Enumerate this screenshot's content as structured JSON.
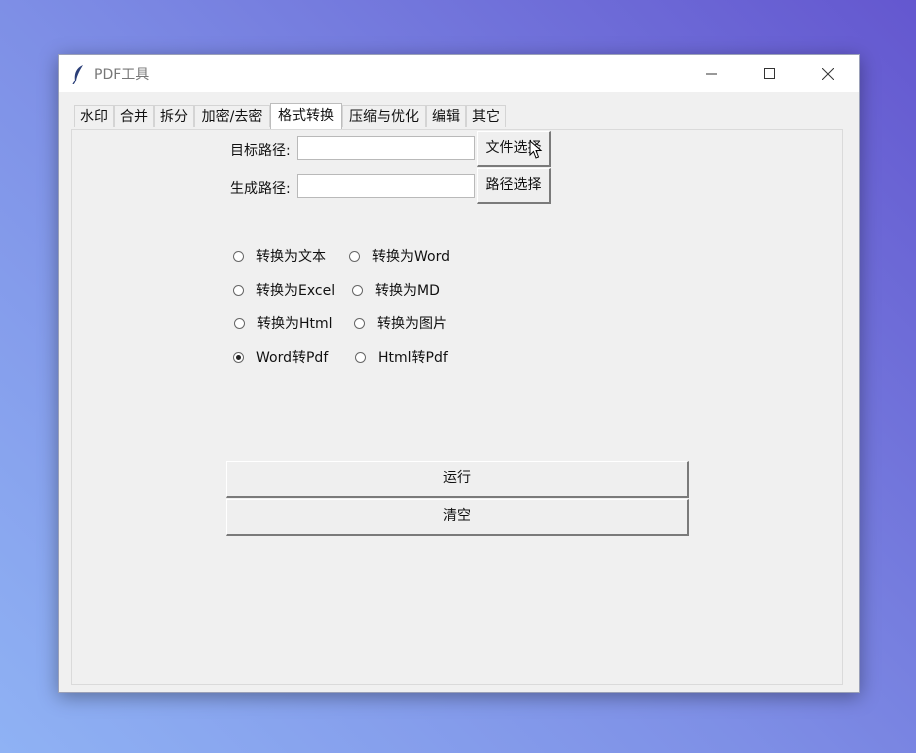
{
  "window": {
    "title": "PDF工具"
  },
  "tabs": [
    {
      "label": "水印",
      "active": false
    },
    {
      "label": "合并",
      "active": false
    },
    {
      "label": "拆分",
      "active": false
    },
    {
      "label": "加密/去密",
      "active": false
    },
    {
      "label": "格式转换",
      "active": true
    },
    {
      "label": "压缩与优化",
      "active": false
    },
    {
      "label": "编辑",
      "active": false
    },
    {
      "label": "其它",
      "active": false
    }
  ],
  "form": {
    "target_label": "目标路径:",
    "target_value": "",
    "file_select_button": "文件选择",
    "output_label": "生成路径:",
    "output_value": "",
    "path_select_button": "路径选择"
  },
  "options": [
    {
      "label": "转换为文本",
      "selected": false
    },
    {
      "label": "转换为Word",
      "selected": false
    },
    {
      "label": "转换为Excel",
      "selected": false
    },
    {
      "label": "转换为MD",
      "selected": false
    },
    {
      "label": "转换为Html",
      "selected": false
    },
    {
      "label": "转换为图片",
      "selected": false
    },
    {
      "label": "Word转Pdf",
      "selected": true
    },
    {
      "label": "Html转Pdf",
      "selected": false
    }
  ],
  "actions": {
    "run": "运行",
    "clear": "清空"
  },
  "icons": {
    "app": "feather-icon",
    "minimize": "minimize-icon",
    "maximize": "maximize-icon",
    "close": "close-icon",
    "cursor": "mouse-cursor-icon"
  }
}
